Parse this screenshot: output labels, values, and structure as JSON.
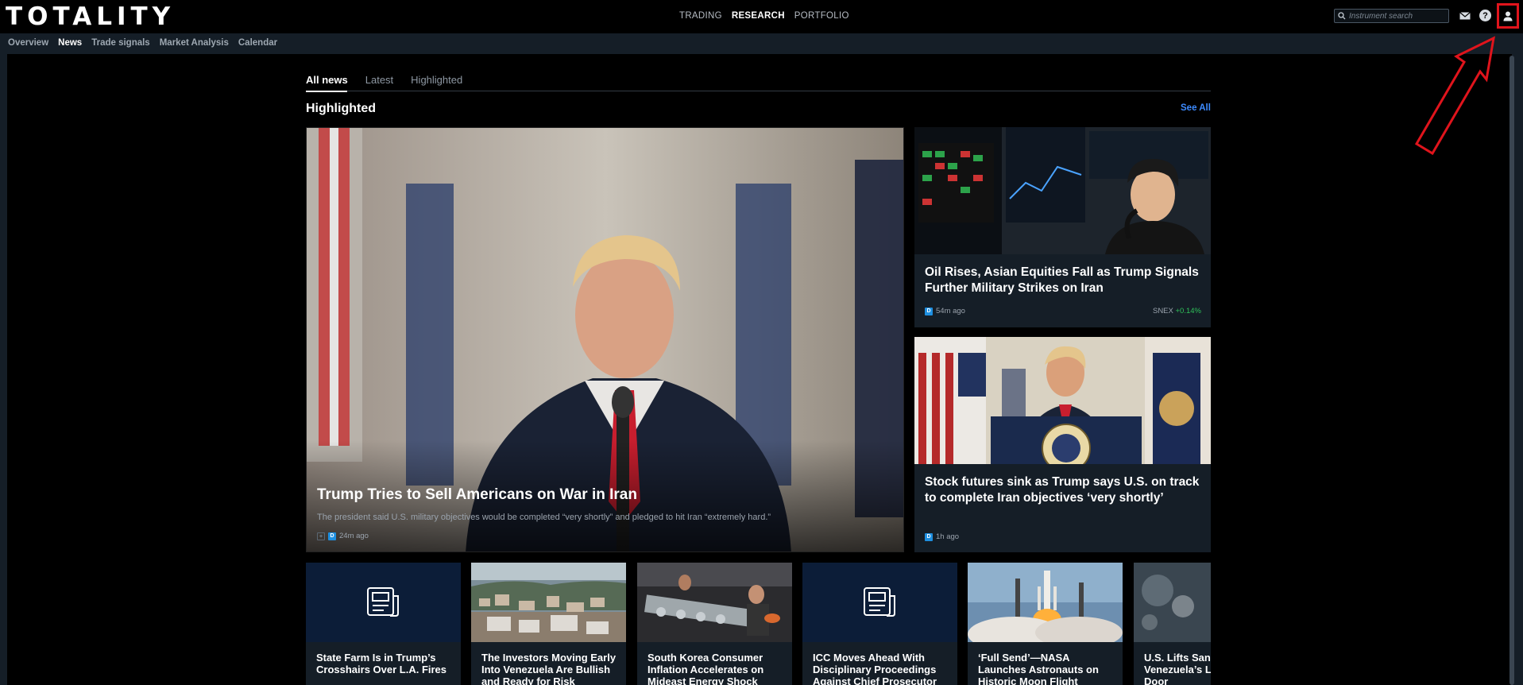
{
  "header": {
    "logo": "TOTALITY",
    "nav": [
      "TRADING",
      "RESEARCH",
      "PORTFOLIO"
    ],
    "nav_active": "RESEARCH",
    "search_placeholder": "Instrument search",
    "help_glyph": "?"
  },
  "subnav": {
    "items": [
      "Overview",
      "News",
      "Trade signals",
      "Market Analysis",
      "Calendar"
    ],
    "active": "News"
  },
  "tabs": {
    "items": [
      "All news",
      "Latest",
      "Highlighted"
    ],
    "active": "All news"
  },
  "section": {
    "title": "Highlighted",
    "see_all": "See All"
  },
  "hero": {
    "title": "Trump Tries to Sell Americans on War in Iran",
    "description": "The president said U.S. military objectives would be completed “very shortly” and pledged to hit Iran “extremely hard.”",
    "source_badge": "D",
    "time": "24m ago"
  },
  "cards": [
    {
      "title": "Oil Rises, Asian Equities Fall as Trump Signals Further Military Strikes on Iran",
      "source_badge": "D",
      "time": "54m ago",
      "ticker": "SNEX",
      "change": "+0.14%"
    },
    {
      "title": "Stock futures sink as Trump says U.S. on track to complete Iran objectives ‘very shortly’",
      "source_badge": "D",
      "time": "1h ago"
    }
  ],
  "small_cards": [
    {
      "title": "State Farm Is in Trump’s Crosshairs Over L.A. Fires"
    },
    {
      "title": "The Investors Moving Early Into Venezuela Are Bullish and Ready for Risk"
    },
    {
      "title": "South Korea Consumer Inflation Accelerates on Mideast Energy Shock"
    },
    {
      "title": "ICC Moves Ahead With Disciplinary Proceedings Against Chief Prosecutor"
    },
    {
      "title": "‘Full Send’—NASA Launches Astronauts on Historic Moon Flight"
    },
    {
      "title": "U.S. Lifts Sanctions on Venezuela’s Leader, Opening Door"
    }
  ],
  "icons": {
    "search": "search-icon",
    "mail": "mail-icon",
    "help": "help-icon",
    "user": "user-icon",
    "newspaper": "newspaper-icon"
  },
  "colors": {
    "background": "#000000",
    "panel": "#151e27",
    "accent_link": "#3d8bff",
    "positive": "#2fc15a",
    "highlight_box": "#e0141c"
  }
}
